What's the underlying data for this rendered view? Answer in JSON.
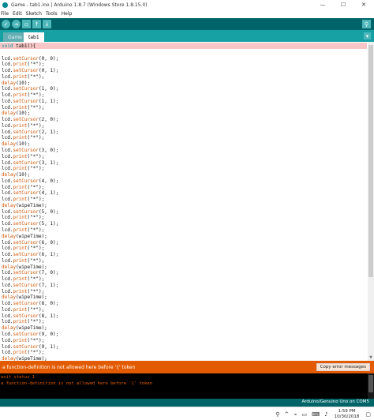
{
  "window": {
    "title": "Game - tab1.ino | Arduino 1.8.7 (Windows Store 1.8.15.0)",
    "minimize": "—",
    "maximize": "☐",
    "close": "✕"
  },
  "menu": [
    "File",
    "Edit",
    "Sketch",
    "Tools",
    "Help"
  ],
  "toolbar": {
    "verify_icon": "✓",
    "upload_icon": "→",
    "new_icon": "▫",
    "open_icon": "↑",
    "save_icon": "↓",
    "serial_icon": "⚲"
  },
  "tabs": {
    "items": [
      "Game",
      "tab1"
    ],
    "menu_icon": "▾"
  },
  "code": {
    "lines": [
      "void tab1(){",
      "",
      "lcd.setCursor(0, 0);",
      "lcd.print(\"*\");",
      "lcd.setCursor(0, 1);",
      "lcd.print(\"*\");",
      "delay(10);",
      "lcd.setCursor(1, 0);",
      "lcd.print(\"*\");",
      "lcd.setCursor(1, 1);",
      "lcd.print(\"*\");",
      "delay(10);",
      "lcd.setCursor(2, 0);",
      "lcd.print(\"*\");",
      "lcd.setCursor(2, 1);",
      "lcd.print(\"*\");",
      "delay(10);",
      "lcd.setCursor(3, 0);",
      "lcd.print(\"*\");",
      "lcd.setCursor(3, 1);",
      "lcd.print(\"*\");",
      "delay(10);",
      "lcd.setCursor(4, 0);",
      "lcd.print(\"*\");",
      "lcd.setCursor(4, 1);",
      "lcd.print(\"*\");",
      "delay(wipeTime);",
      "lcd.setCursor(5, 0);",
      "lcd.print(\"*\");",
      "lcd.setCursor(5, 1);",
      "lcd.print(\"*\");",
      "delay(wipeTime);",
      "lcd.setCursor(6, 0);",
      "lcd.print(\"*\");",
      "lcd.setCursor(6, 1);",
      "lcd.print(\"*\");",
      "delay(wipeTime);",
      "lcd.setCursor(7, 0);",
      "lcd.print(\"*\");",
      "lcd.setCursor(7, 1);",
      "lcd.print(\"*\");",
      "delay(wipeTime);",
      "lcd.setCursor(8, 0);",
      "lcd.print(\"*\");",
      "lcd.setCursor(8, 1);",
      "lcd.print(\"*\");",
      "delay(wipeTime);",
      "lcd.setCursor(9, 0);",
      "lcd.print(\"*\");",
      "lcd.setCursor(9, 1);",
      "lcd.print(\"*\");",
      "delay(wipeTime);"
    ],
    "colors": {
      "function": "#d35400",
      "type": "#00979c",
      "error_highlight": "#f7c6c6"
    }
  },
  "status": {
    "message": "a function-definition is not allowed here before '{' token",
    "copy_button": "Copy error messages",
    "color": "#e35b00"
  },
  "console": {
    "lines": [
      "exit status 1",
      "a function-definition is not allowed here before '{' token"
    ]
  },
  "board": {
    "text": "Arduino/Genuino Uno on COM5"
  },
  "taskbar": {
    "time": "1:59 PM",
    "date": "10/30/2018",
    "icons": {
      "person": "⚲",
      "chevron": "^",
      "network": "⌁",
      "battery": "▭",
      "keyboard": "⌨",
      "volume": "♪",
      "notifications": "▢"
    }
  }
}
